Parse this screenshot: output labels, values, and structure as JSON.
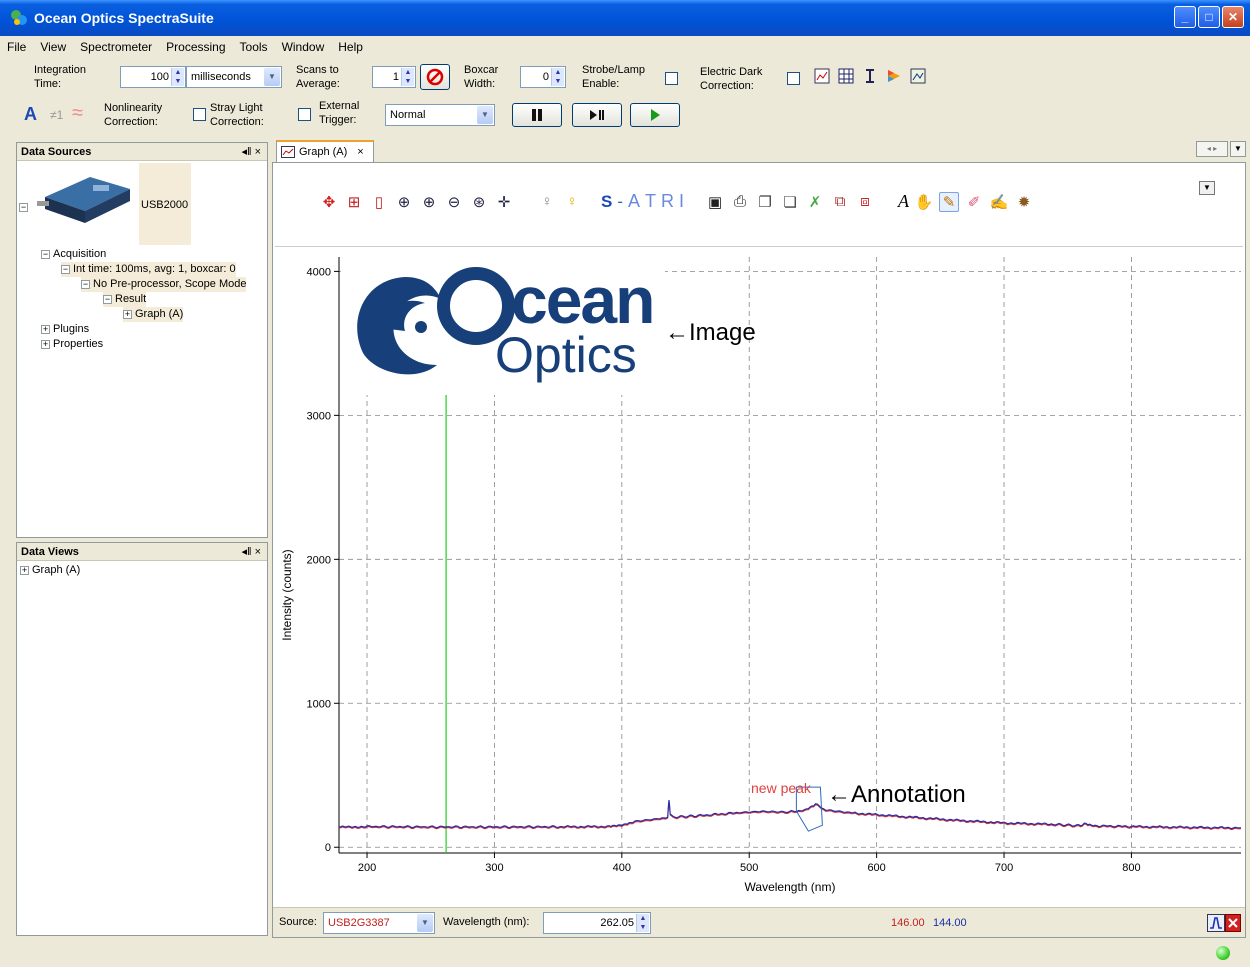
{
  "window": {
    "title": "Ocean Optics SpectraSuite",
    "minimize": "_",
    "maximize": "□",
    "close": "✕"
  },
  "menu": [
    "File",
    "View",
    "Spectrometer",
    "Processing",
    "Tools",
    "Window",
    "Help"
  ],
  "toolbar": {
    "integration_label_1": "Integration",
    "integration_label_2": "Time:",
    "integration_value": "100",
    "integration_unit": "milliseconds",
    "scans_label_1": "Scans to",
    "scans_label_2": "Average:",
    "scans_value": "1",
    "boxcar_label_1": "Boxcar",
    "boxcar_label_2": "Width:",
    "boxcar_value": "0",
    "strobe_label_1": "Strobe/Lamp",
    "strobe_label_2": "Enable:",
    "dark_label_1": "Electric Dark",
    "dark_label_2": "Correction:",
    "nonlin_label_1": "Nonlinearity",
    "nonlin_label_2": "Correction:",
    "stray_label_1": "Stray Light",
    "stray_label_2": "Correction:",
    "trigger_label_1": "External",
    "trigger_label_2": "Trigger:",
    "trigger_mode": "Normal",
    "icon_a": "A",
    "icon_ne": "≠1",
    "icon_wave": "≈"
  },
  "data_sources": {
    "title": "Data Sources",
    "ctl": "◂‖ ×",
    "device": "USB2000",
    "tree": [
      {
        "label": "Acquisition",
        "level": 0
      },
      {
        "label": "Int time: 100ms, avg: 1, boxcar: 0",
        "level": 1
      },
      {
        "label": "No Pre-processor, Scope Mode",
        "level": 2
      },
      {
        "label": "Result",
        "level": 3
      },
      {
        "label": "Graph (A)",
        "level": 4
      },
      {
        "label": "Plugins",
        "level": 0
      },
      {
        "label": "Properties",
        "level": 0
      }
    ]
  },
  "data_views": {
    "title": "Data Views",
    "ctl": "◂‖ ×",
    "item": "Graph (A)"
  },
  "graph_tab": {
    "label": "Graph (A)",
    "close": "×"
  },
  "graph_toolbar": {
    "letters": [
      "S",
      "-",
      "A",
      "T",
      "R",
      "I"
    ],
    "italic_a": "A"
  },
  "logo": {
    "line1": "cean",
    "line2": "Optics"
  },
  "callouts": {
    "image": "←Image",
    "annotation": "←Annotation",
    "annotation_text": "new peak"
  },
  "chart_data": {
    "type": "line",
    "xlabel": "Wavelength (nm)",
    "ylabel": "Intensity (counts)",
    "xlim": [
      178,
      886
    ],
    "ylim": [
      -40,
      4100
    ],
    "xticks": [
      200,
      300,
      400,
      500,
      600,
      700,
      800
    ],
    "yticks": [
      0,
      1000,
      2000,
      3000,
      4000
    ],
    "grid": true,
    "cursor_x": 262.05,
    "series": [
      {
        "color": "#2a2aa8",
        "x": [
          178,
          200,
          250,
          300,
          350,
          390,
          400,
          410,
          430,
          436,
          437,
          438,
          440,
          460,
          490,
          510,
          530,
          545,
          552,
          560,
          580,
          620,
          660,
          700,
          740,
          760,
          763,
          770,
          800,
          840,
          886
        ],
        "y": [
          140,
          145,
          142,
          142,
          143,
          145,
          155,
          180,
          200,
          210,
          330,
          230,
          210,
          220,
          240,
          250,
          245,
          260,
          300,
          260,
          240,
          215,
          190,
          170,
          160,
          150,
          170,
          150,
          145,
          140,
          135
        ]
      }
    ]
  },
  "footer": {
    "source_label": "Source:",
    "source_value": "USB2G3387",
    "wavelength_label": "Wavelength (nm):",
    "wavelength_value": "262.05",
    "value_red": "146.00",
    "value_blue": "144.00"
  }
}
